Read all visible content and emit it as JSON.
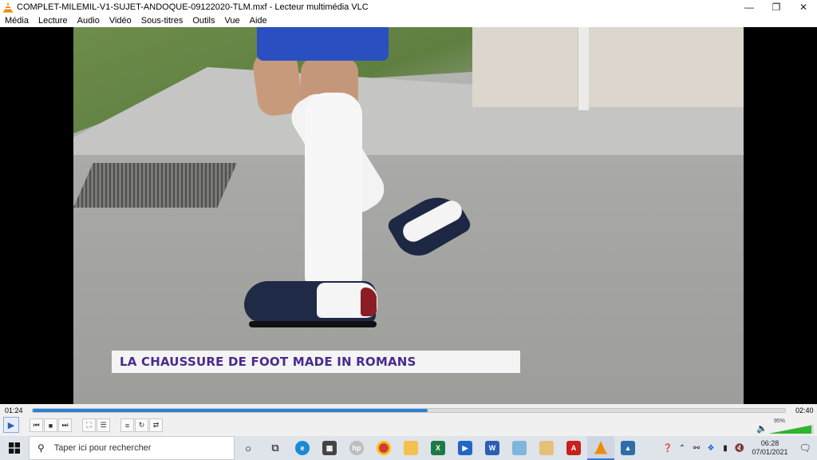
{
  "window": {
    "title": "COMPLET-MILEMIL-V1-SUJET-ANDOQUE-09122020-TLM.mxf - Lecteur multimédia VLC",
    "minimize_icon": "minimize-icon",
    "restore_icon": "restore-icon",
    "close_icon": "close-icon"
  },
  "menu": [
    "Média",
    "Lecture",
    "Audio",
    "Vidéo",
    "Sous-titres",
    "Outils",
    "Vue",
    "Aide"
  ],
  "video": {
    "caption": "LA CHAUSSURE DE FOOT MADE IN ROMANS"
  },
  "player": {
    "elapsed": "01:24",
    "total": "02:40",
    "progress_fraction": 0.525,
    "volume_label": "95%",
    "volume_fraction": 0.95,
    "accent": "#2b7fd6",
    "volume_color": "#2fb52f"
  },
  "controls": [
    "play-icon",
    "previous-icon",
    "stop-icon",
    "next-icon",
    "fullscreen-icon",
    "extended-settings-icon",
    "playlist-icon",
    "loop-icon",
    "shuffle-icon"
  ],
  "taskbar": {
    "search_placeholder": "Taper ici pour rechercher",
    "time": "06:28",
    "date": "07/01/2021"
  }
}
